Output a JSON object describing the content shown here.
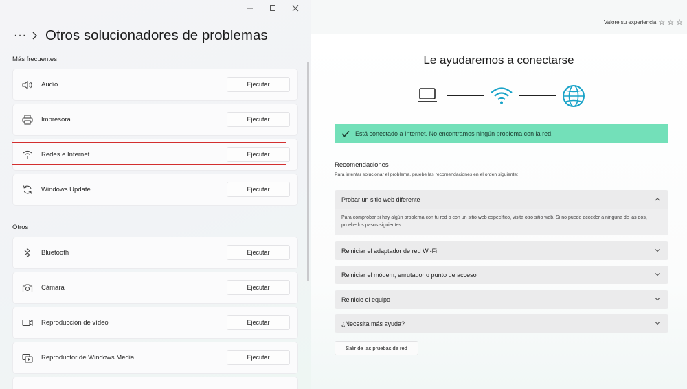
{
  "left_window": {
    "title": "Otros solucionadores de problemas",
    "more_label": "···",
    "section_frequent": "Más frecuentes",
    "section_others": "Otros",
    "frequent_items": [
      {
        "label": "Audio",
        "button": "Ejecutar",
        "icon": "speaker-icon"
      },
      {
        "label": "Impresora",
        "button": "Ejecutar",
        "icon": "printer-icon"
      },
      {
        "label": "Redes e Internet",
        "button": "Ejecutar",
        "icon": "network-icon",
        "highlight_color": "#d32f2f"
      },
      {
        "label": "Windows Update",
        "button": "Ejecutar",
        "icon": "sync-icon"
      }
    ],
    "other_items": [
      {
        "label": "Bluetooth",
        "button": "Ejecutar",
        "icon": "bluetooth-icon"
      },
      {
        "label": "Cámara",
        "button": "Ejecutar",
        "icon": "camera-icon"
      },
      {
        "label": "Reproducción de vídeo",
        "button": "Ejecutar",
        "icon": "video-icon"
      },
      {
        "label": "Reproductor de Windows Media",
        "button": "Ejecutar",
        "icon": "media-player-icon"
      }
    ]
  },
  "right_window": {
    "rate_label": "Valore su experiencia",
    "title": "Le ayudaremos a conectarse",
    "status_message": "Está conectado a Internet. No encontramos ningún problema con la red.",
    "status_color": "#73e0b9",
    "accent_color": "#1aa3c8",
    "recommendations_heading": "Recomendaciones",
    "recommendations_sub": "Para intentar solucionar el problema, pruebe las recomendaciones en el orden siguiente:",
    "accordions": [
      {
        "title": "Probar un sitio web diferente",
        "expanded": true,
        "body": "Para comprobar si hay algún problema con tu red o con un sitio web específico, visita otro sitio web. Si no puede acceder a ninguna de las dos, pruebe los pasos siguientes."
      },
      {
        "title": "Reiniciar el adaptador de red Wi-Fi",
        "expanded": false
      },
      {
        "title": "Reiniciar el módem, enrutador o punto de acceso",
        "expanded": false
      },
      {
        "title": "Reinicie el equipo",
        "expanded": false
      },
      {
        "title": "¿Necesita más ayuda?",
        "expanded": false
      }
    ],
    "exit_button": "Salir de las pruebas de red"
  }
}
